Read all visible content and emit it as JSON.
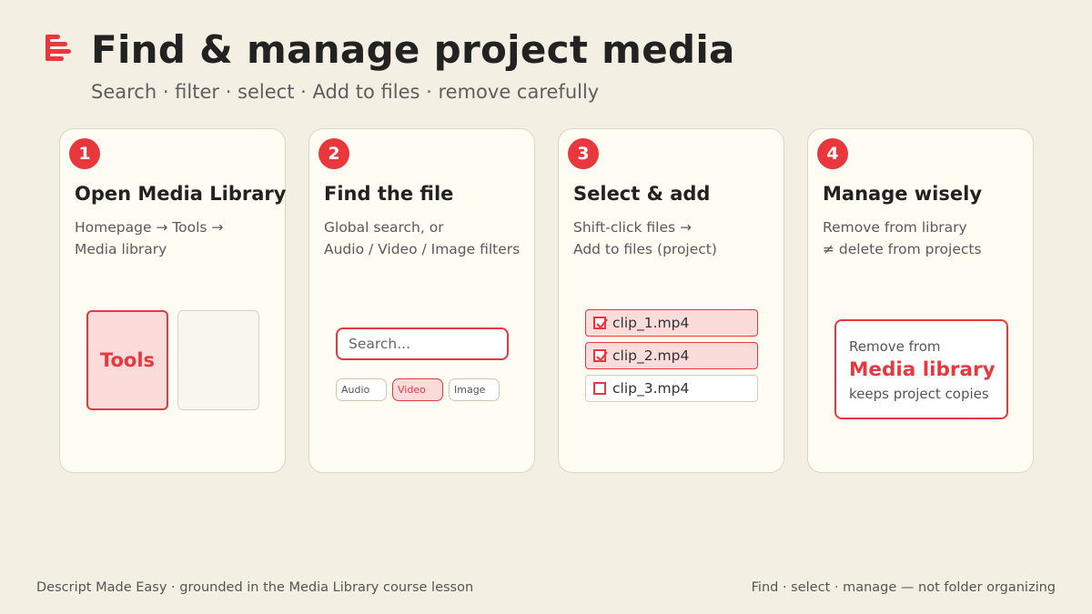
{
  "header": {
    "logo_icon": "descript-logo-icon",
    "title": "Find & manage project media",
    "subtitle": "Search · filter · select · Add to files · remove carefully"
  },
  "accent_color": "#e8383d",
  "steps": [
    {
      "number": "1",
      "title": "Open Media Library",
      "desc": [
        "Homepage → Tools →",
        "Media library"
      ],
      "visual": {
        "tools_tile": "Tools"
      }
    },
    {
      "number": "2",
      "title": "Find the file",
      "desc": [
        "Global search, or",
        "Audio / Video / Image filters"
      ],
      "visual": {
        "search_placeholder": "Search...",
        "filters": [
          "Audio",
          "Video",
          "Image"
        ],
        "active_filter": "Video"
      }
    },
    {
      "number": "3",
      "title": "Select & add",
      "desc": [
        "Shift-click files →",
        "Add to files (project)"
      ],
      "visual": {
        "files": [
          {
            "name": "clip_1.mp4",
            "checked": true
          },
          {
            "name": "clip_2.mp4",
            "checked": true
          },
          {
            "name": "clip_3.mp4",
            "checked": false
          }
        ]
      }
    },
    {
      "number": "4",
      "title": "Manage wisely",
      "desc": [
        "Remove from library",
        "≠ delete from projects"
      ],
      "visual": {
        "line1": "Remove from",
        "line2": "Media library",
        "line3": "keeps project copies"
      }
    }
  ],
  "footer": {
    "left": "Descript Made Easy · grounded in the Media Library course lesson",
    "right": "Find · select · manage — not folder organizing"
  }
}
